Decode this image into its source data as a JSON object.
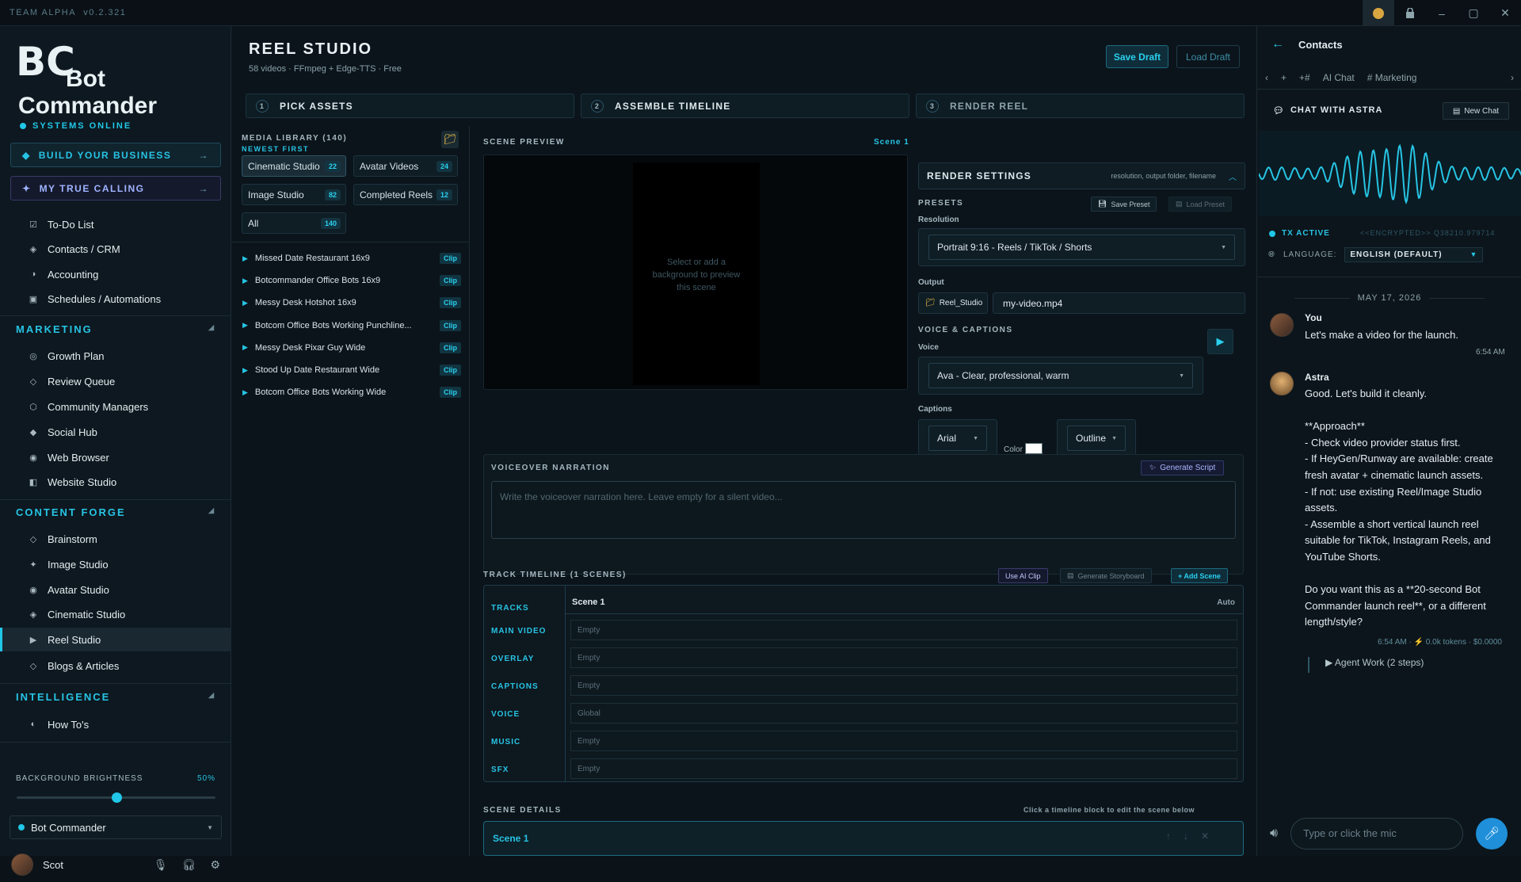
{
  "titlebar": {
    "brand": "TEAM ALPHA",
    "version": "v0.2.321"
  },
  "sidebar": {
    "logo_mark": "BC",
    "logo_line1": "Bot",
    "logo_line2": "Commander",
    "status": "SYSTEMS ONLINE",
    "cta1": "BUILD YOUR BUSINESS",
    "cta2": "MY TRUE CALLING",
    "items_top": [
      "To-Do List",
      "Contacts / CRM",
      "Accounting",
      "Schedules / Automations"
    ],
    "sec_marketing": "MARKETING",
    "items_marketing": [
      "Growth Plan",
      "Review Queue",
      "Community Managers",
      "Social Hub",
      "Web Browser",
      "Website Studio"
    ],
    "sec_content": "CONTENT FORGE",
    "items_content": [
      "Brainstorm",
      "Image Studio",
      "Avatar Studio",
      "Cinematic Studio",
      "Reel Studio",
      "Blogs & Articles"
    ],
    "sec_intel": "INTELLIGENCE",
    "items_intel": [
      "How To's"
    ],
    "brightness_label": "BACKGROUND BRIGHTNESS",
    "brightness_value": "50%",
    "brightness_level": 0.5,
    "bot_select": "Bot Commander",
    "user_name": "Scot"
  },
  "main": {
    "title": "REEL STUDIO",
    "subtitle": "58 videos · FFmpeg + Edge-TTS · Free",
    "save_draft": "Save Draft",
    "load_draft": "Load Draft",
    "steps": [
      {
        "num": "1",
        "label": "PICK ASSETS"
      },
      {
        "num": "2",
        "label": "ASSEMBLE TIMELINE"
      },
      {
        "num": "3",
        "label": "RENDER REEL"
      }
    ],
    "media": {
      "title": "MEDIA LIBRARY (140)",
      "sort": "NEWEST FIRST",
      "filters": [
        {
          "label": "Cinematic Studio",
          "count": "22"
        },
        {
          "label": "Avatar Videos",
          "count": "24"
        },
        {
          "label": "Image Studio",
          "count": "82"
        },
        {
          "label": "Completed Reels",
          "count": "12"
        },
        {
          "label": "All",
          "count": "140"
        }
      ],
      "clips": [
        "Missed Date Restaurant 16x9",
        "Botcommander Office Bots 16x9",
        "Messy Desk Hotshot 16x9",
        "Botcom Office Bots Working Punchline...",
        "Messy Desk Pixar Guy Wide",
        "Stood Up Date Restaurant Wide",
        "Botcom Office Bots Working Wide"
      ],
      "clip_tag": "Clip"
    },
    "preview": {
      "title": "SCENE PREVIEW",
      "scene": "Scene 1",
      "hint": "Select or add a background to preview this scene"
    },
    "render": {
      "title": "RENDER SETTINGS",
      "subtitle": "resolution, output folder, filename",
      "presets_label": "PRESETS",
      "save_preset": "Save Preset",
      "load_preset": "Load Preset",
      "resolution_label": "Resolution",
      "resolution": "Portrait 9:16 - Reels / TikTok / Shorts",
      "output_label": "Output",
      "folder": "Reel_Studio",
      "filename": "my-video.mp4",
      "voice_section": "VOICE & CAPTIONS",
      "voice_label": "Voice",
      "voice": "Ava - Clear, professional, warm",
      "captions_label": "Captions",
      "font": "Arial",
      "color_label": "Color",
      "caption_color": "#ffffff",
      "style": "Outline"
    },
    "voiceover": {
      "title": "VOICEOVER NARRATION",
      "generate": "Generate Script",
      "placeholder": "Write the voiceover narration here. Leave empty for a silent video..."
    },
    "timeline": {
      "title": "TRACK TIMELINE (1 SCENES)",
      "use_ai": "Use AI Clip",
      "storyboard": "Generate Storyboard",
      "add_scene": "+ Add Scene",
      "tracks_header": "TRACKS",
      "scene": "Scene 1",
      "auto": "Auto",
      "tracks": [
        {
          "name": "MAIN VIDEO",
          "value": "Empty"
        },
        {
          "name": "OVERLAY",
          "value": "Empty"
        },
        {
          "name": "CAPTIONS",
          "value": "Empty"
        },
        {
          "name": "VOICE",
          "value": "Global"
        },
        {
          "name": "MUSIC",
          "value": "Empty"
        },
        {
          "name": "SFX",
          "value": "Empty"
        }
      ]
    },
    "details": {
      "title": "SCENE DETAILS",
      "hint": "Click a timeline block to edit the scene below",
      "scene": "Scene 1"
    }
  },
  "chat": {
    "title": "Contacts",
    "tabs": [
      "AI Chat",
      "# Marketing"
    ],
    "chat_with": "CHAT WITH ASTRA",
    "new_chat": "New Chat",
    "tx": "TX ACTIVE",
    "encrypted": "<<ENCRYPTED>> Q38210.979714",
    "language_label": "LANGUAGE:",
    "language": "ENGLISH (DEFAULT)",
    "date": "MAY 17, 2026",
    "msg1": {
      "name": "You",
      "text": "Let's make a video for the launch.",
      "time": "6:54 AM"
    },
    "msg2": {
      "name": "Astra",
      "text": "Good. Let's build it cleanly.\n\n**Approach**\n- Check video provider status first.\n- If HeyGen/Runway are available: create fresh avatar + cinematic launch assets.\n- If not: use existing Reel/Image Studio assets.\n- Assemble a short vertical launch reel suitable for TikTok, Instagram Reels, and YouTube Shorts.\n\nDo you want this as a **20-second Bot Commander launch reel**, or a different length/style?",
      "meta": "6:54 AM · ⚡ 0.0k tokens · $0.0000"
    },
    "agent_work": "▶ Agent Work (2 steps)",
    "input_placeholder": "Type or click the mic"
  }
}
